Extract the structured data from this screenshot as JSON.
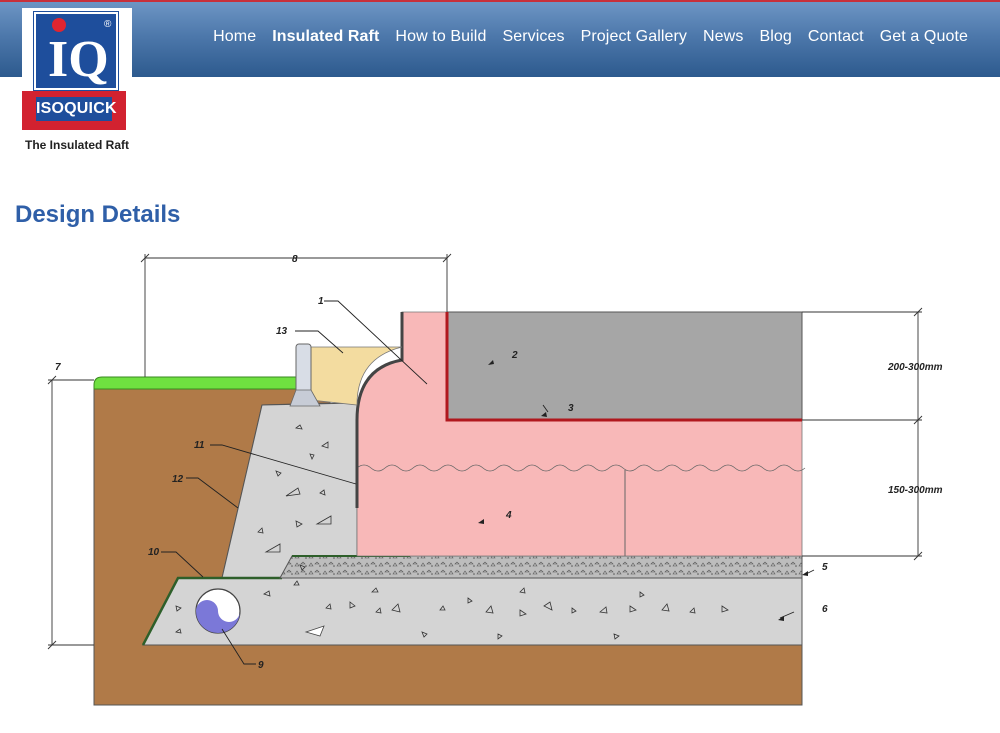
{
  "nav": {
    "items": [
      {
        "label": "Home"
      },
      {
        "label": "Insulated Raft"
      },
      {
        "label": "How to Build"
      },
      {
        "label": "Services"
      },
      {
        "label": "Project Gallery"
      },
      {
        "label": "News"
      },
      {
        "label": "Blog"
      },
      {
        "label": "Contact"
      },
      {
        "label": "Get a Quote"
      }
    ],
    "active": "Insulated Raft"
  },
  "logo": {
    "letters": "IQ",
    "name": "ISOQUICK",
    "tagline": "The Insulated Raft",
    "registered": "®"
  },
  "page": {
    "title": "Design Details"
  },
  "diagram": {
    "labels": {
      "n1": "1",
      "n2": "2",
      "n3": "3",
      "n4": "4",
      "n5": "5",
      "n6": "6",
      "n7": "7",
      "n8": "8",
      "n9": "9",
      "n10": "10",
      "n11": "11",
      "n12": "12",
      "n13": "13"
    },
    "dimensions": {
      "upper": "200-300mm",
      "lower": "150-300mm"
    }
  },
  "colors": {
    "header_top": "#6d95c4",
    "header_bottom": "#2d5a8e",
    "title": "#2f5fa8",
    "insulation": "#f8b8b8",
    "slab": "#a6a6a6",
    "soil": "#b07a48",
    "grass": "#6fe040",
    "concrete": "#d4d4d4",
    "sealant": "#f3dca0",
    "pipe": "#7b78d8",
    "membrane": "#b0181e"
  }
}
